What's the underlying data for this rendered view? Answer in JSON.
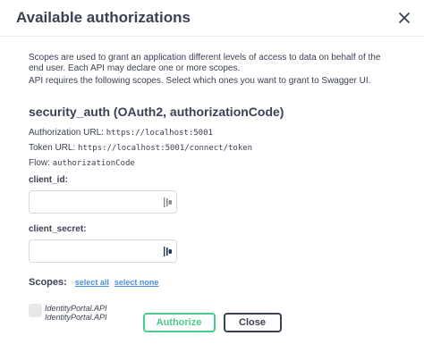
{
  "modal": {
    "title": "Available authorizations",
    "description": "Scopes are used to grant an application different levels of access to data on behalf of the end user. Each API may declare one or more scopes.",
    "requirement": "API requires the following scopes. Select which ones you want to grant to Swagger UI."
  },
  "auth": {
    "title": "security_auth (OAuth2, authorizationCode)",
    "authorization_url_label": "Authorization URL:",
    "authorization_url": "https://localhost:5001",
    "token_url_label": "Token URL:",
    "token_url": "https://localhost:5001/connect/token",
    "flow_label": "Flow:",
    "flow": "authorizationCode",
    "client_id_label": "client_id:",
    "client_id_value": "",
    "client_secret_label": "client_secret:",
    "client_secret_value": ""
  },
  "scopes": {
    "label": "Scopes:",
    "select_all": "select all",
    "select_none": "select none",
    "items": [
      {
        "name": "IdentityPortal.API",
        "description": "IdentityPortal.API",
        "checked": false
      }
    ]
  },
  "buttons": {
    "authorize": "Authorize",
    "close": "Close"
  },
  "colors": {
    "accent_green": "#49cc90",
    "link_blue": "#4990e2",
    "text": "#3b4151"
  },
  "icons": {
    "close": "close-icon",
    "password_manager": "password-manager-icon"
  }
}
